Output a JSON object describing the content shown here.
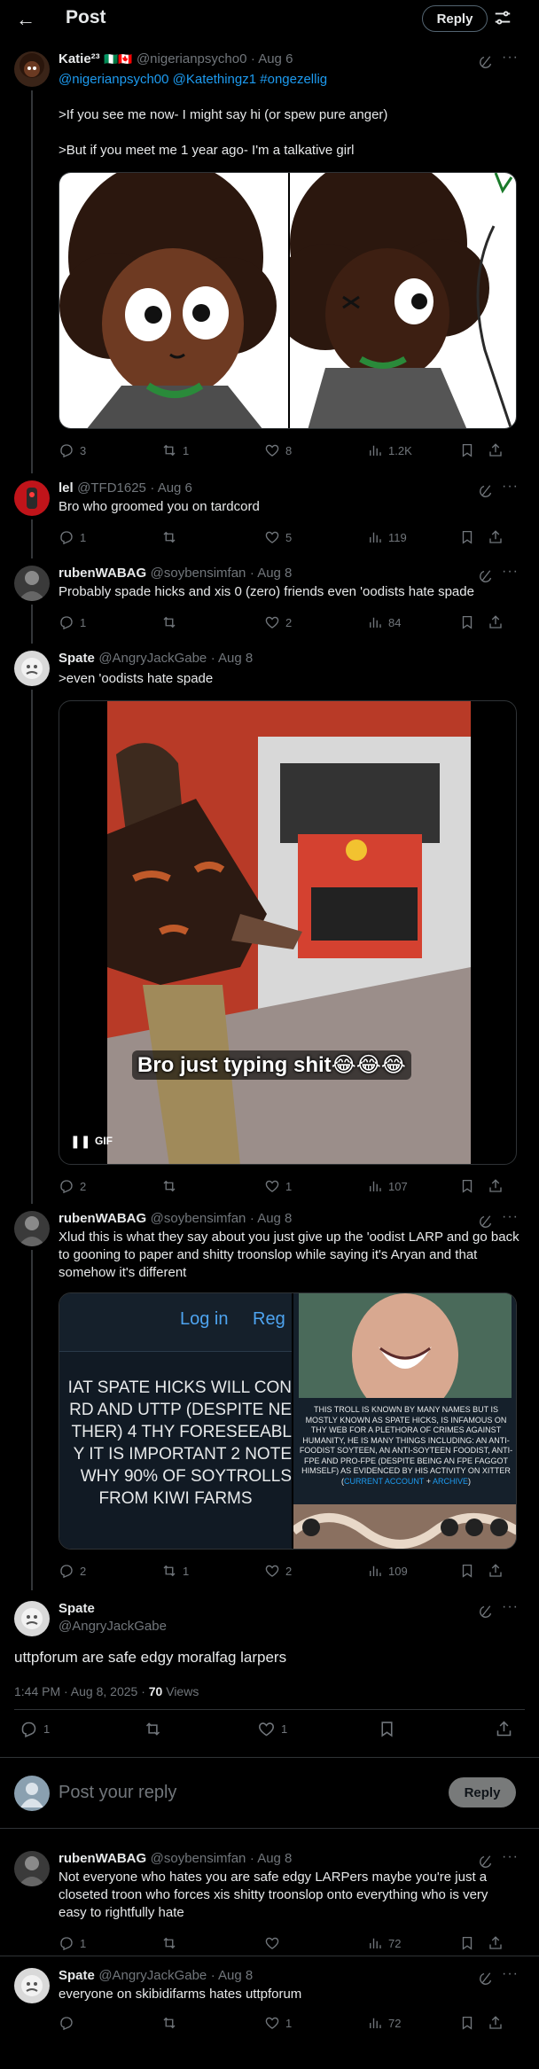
{
  "header": {
    "title": "Post",
    "reply_button": "Reply",
    "back_icon": "arrow-left-icon",
    "filter_icon": "sliders-icon"
  },
  "posts": [
    {
      "name": "Katie²³",
      "flags": "🇳🇬🇨🇦",
      "handle": "@nigerianpsycho0",
      "date": "· Aug 6",
      "mentions": "@nigerianpsych00 @Katethingz1 #ongezellig",
      "text1": ">If you see me now- I might say hi (or spew pure anger)",
      "text2": ">But if you meet me 1 year ago- I'm a talkative girl",
      "replies": "3",
      "reposts": "1",
      "likes": "8",
      "views": "1.2K"
    },
    {
      "name": "lel",
      "handle": "@TFD1625",
      "date": "· Aug 6",
      "text": "Bro who groomed you on tardcord",
      "replies": "1",
      "reposts": "",
      "likes": "5",
      "views": "119"
    },
    {
      "name": "rubenWABAG",
      "handle": "@soybensimfan",
      "date": "· Aug 8",
      "text": "Probably spade hicks and xis 0 (zero) friends even 'oodists hate spade",
      "replies": "1",
      "reposts": "",
      "likes": "2",
      "views": "84"
    },
    {
      "name": "Spate",
      "handle": "@AngryJackGabe",
      "date": "· Aug 8",
      "text": ">even 'oodists hate spade",
      "video_caption": "Bro just typing shit😂😂😂",
      "gif_label": "GIF",
      "replies": "2",
      "reposts": "",
      "likes": "1",
      "views": "107"
    },
    {
      "name": "rubenWABAG",
      "handle": "@soybensimfan",
      "date": "· Aug 8",
      "text": "Xlud this is what they say about you just give up the 'oodist LARP and go back to gooning to paper and shitty troonslop while saying it's Aryan and that somehow it's different",
      "img1_login": "Log in",
      "img1_reg": "Reg",
      "img1_lines": [
        "IAT SPATE HICKS WILL CON",
        "RD AND UTTP (DESPITE NE",
        "THER) 4 THY FORESEEABL",
        "Y IT IS IMPORTANT 2 NOTE",
        "WHY 90% OF SOYTROLLS",
        "FROM KIWI FARMS"
      ],
      "img2_text": "THIS TROLL IS KNOWN BY MANY NAMES BUT IS MOSTLY KNOWN AS SPATE HICKS, IS INFAMOUS ON THY WEB FOR A PLETHORA OF CRIMES AGAINST HUMANITY, HE IS MANY THINGS INCLUDING: AN ANTI-FOODIST SOYTEEN, AN ANTI-SOYTEEN FOODIST, ANTI-FPE AND PRO-FPE (DESPITE BEING AN FPE FAGGOT HIMSELF) AS EVIDENCED BY HIS ACTIVITY ON XITTER (",
      "img2_link": "CURRENT ACCOUNT",
      "img2_mid": " + ",
      "img2_link2": "ARCHIVE",
      "img2_end": ")",
      "replies": "2",
      "reposts": "1",
      "likes": "2",
      "views": "109"
    }
  ],
  "main_post": {
    "name": "Spate",
    "handle": "@AngryJackGabe",
    "text": "uttpforum are safe edgy moralfag larpers",
    "time": "1:44 PM · Aug 8, 2025 · ",
    "views_count": "70",
    "views_label": " Views",
    "replies": "1",
    "likes": "1"
  },
  "composer": {
    "placeholder": "Post your reply",
    "button": "Reply"
  },
  "replies_below": [
    {
      "name": "rubenWABAG",
      "handle": "@soybensimfan",
      "date": "· Aug 8",
      "text": "Not everyone who hates you are safe edgy LARPers maybe you're just a closeted troon who forces xis shitty troonslop onto everything who is very easy to rightfully hate",
      "replies": "1",
      "likes": "",
      "views": "72"
    },
    {
      "name": "Spate",
      "handle": "@AngryJackGabe",
      "date": "· Aug 8",
      "text": "everyone on skibidifarms hates uttpforum",
      "replies": "",
      "likes": "1",
      "views": "72"
    }
  ],
  "colors": {
    "background": "#000000",
    "text": "#e7e9ea",
    "muted": "#71767b",
    "link": "#1d9bf0",
    "divider": "#2f3336"
  }
}
